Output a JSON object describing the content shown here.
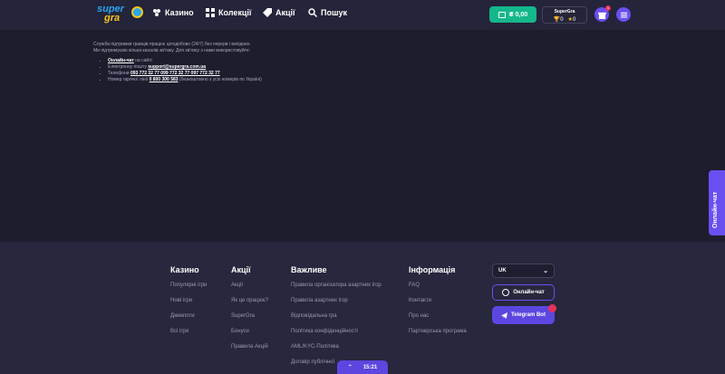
{
  "header": {
    "logo": {
      "line1": "super",
      "line2": "gra"
    },
    "nav": [
      {
        "label": "Казино",
        "icon": "casino-icon"
      },
      {
        "label": "Колекції",
        "icon": "grid-icon"
      },
      {
        "label": "Акції",
        "icon": "tag-icon"
      },
      {
        "label": "Пошук",
        "icon": "search-icon"
      }
    ],
    "balance": "₴ 0,00",
    "points": {
      "name": "SuperGra",
      "trophies": "0",
      "stars": "0"
    },
    "notifications_count": "1"
  },
  "support": {
    "line1": "Служба підтримки гравців працює цілодобово (24/7) без перерв і вихідних.",
    "line2": "Ми підтримуємо кілька каналів зв'язку. Для зв'язку з нами використовуйте:",
    "items": [
      {
        "prefix": "",
        "link": "Онлайн-чат",
        "suffix": " на сайті"
      },
      {
        "prefix": "Електронну пошту ",
        "link": "support@supergra.com.ua",
        "suffix": ""
      },
      {
        "prefix": "Телефони ",
        "link": "093 772 32 77  099 772 32 77  097 772 32 77",
        "suffix": ""
      },
      {
        "prefix": "Номер гарячої лінії ",
        "link": "0 800 300 583",
        "suffix": " (безкоштовно з усіх номерів по Україні)"
      }
    ]
  },
  "side_chat": "Онлайн-чат",
  "footer": {
    "columns": [
      {
        "title": "Казино",
        "links": [
          "Популярні ігри",
          "Нові ігри",
          "Джекпоти",
          "Всі ігри"
        ]
      },
      {
        "title": "Акції",
        "links": [
          "Акції",
          "Як це працює?",
          "SuperGra",
          "Бонуси",
          "Правила Акцій"
        ]
      },
      {
        "title": "Важливе",
        "links": [
          "Правила організатора азартних ігор",
          "Правила азартних ігор",
          "Відповідальна гра",
          "Політика конфіденційності",
          "AML/KYC-Політика",
          "Договір публічної"
        ]
      },
      {
        "title": "Інформація",
        "links": [
          "FAQ",
          "Контакти",
          "Про нас",
          "Партнерська програма"
        ]
      }
    ],
    "language": "UK",
    "chat_button": "Онлайн-чат",
    "telegram_button": "Telegram Bot"
  },
  "time": "15:21",
  "colors": {
    "accent": "#6a4ff0",
    "balance": "#14b88b",
    "background": "#1d1d2e"
  }
}
